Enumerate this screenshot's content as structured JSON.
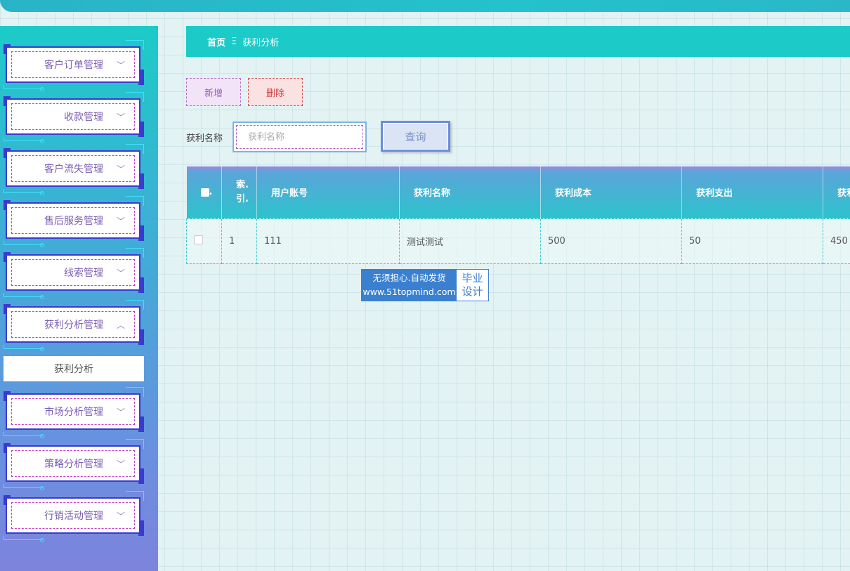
{
  "sidebar": {
    "items": [
      {
        "label": "客户订单管理",
        "chevron": "﹀"
      },
      {
        "label": "收款管理",
        "chevron": "﹀"
      },
      {
        "label": "客户流失管理",
        "chevron": "﹀"
      },
      {
        "label": "售后服务管理",
        "chevron": "﹀"
      },
      {
        "label": "线索管理",
        "chevron": "﹀"
      },
      {
        "label": "获利分析管理",
        "chevron": "︿"
      },
      {
        "label": "市场分析管理",
        "chevron": "﹀"
      },
      {
        "label": "策略分析管理",
        "chevron": "﹀"
      },
      {
        "label": "行销活动管理",
        "chevron": "﹀"
      }
    ],
    "active_sub": "获利分析"
  },
  "breadcrumb": {
    "home": "首页",
    "separator": "Ξ",
    "current": "获利分析"
  },
  "actions": {
    "add": "新增",
    "delete": "删除"
  },
  "search": {
    "label": "获利名称",
    "placeholder": "获利名称",
    "value": "",
    "query": "查询"
  },
  "table": {
    "headers": [
      "索引",
      "用户账号",
      "获利名称",
      "获利成本",
      "获利支出",
      "获利"
    ],
    "index_header_lines": [
      "索.",
      "引."
    ],
    "rows": [
      {
        "index": "1",
        "account": "111",
        "name": "测试测试",
        "cost": "500",
        "expense": "50",
        "profit": "450"
      }
    ]
  },
  "watermark": {
    "line1": "无须担心.自动发货",
    "line2": "www.51topmind.com",
    "tag1": "毕业",
    "tag2": "设计"
  },
  "colors": {
    "teal": "#1ccbc8",
    "sidebar_bottom": "#7d84dc",
    "menu_border": "#3a3ad0",
    "menu_text": "#7d5fb4"
  }
}
